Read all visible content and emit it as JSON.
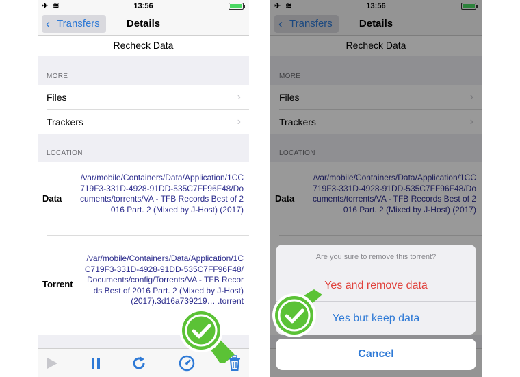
{
  "status_bar": {
    "left": "✈ ≋",
    "time": "13:56",
    "battery_level": 0.9
  },
  "nav": {
    "back_label": "Transfers",
    "back_chevron": "‹",
    "title": "Details"
  },
  "recheck_label": "Recheck Data",
  "more_section": {
    "header": "MORE",
    "items": [
      {
        "label": "Files",
        "chevron": "›"
      },
      {
        "label": "Trackers",
        "chevron": "›"
      }
    ]
  },
  "location_section": {
    "header": "LOCATION",
    "data_label": "Data",
    "data_value": "/var/mobile/Containers/Data/Application/1CC719F3-331D-4928-91DD-535C7FF96F48/Documents/torrents/VA - TFB Records Best of 2016 Part. 2 (Mixed by J-Host) (2017)",
    "torrent_label": "Torrent",
    "torrent_value": "/var/mobile/Containers/Data/Application/1CC719F3-331D-4928-91DD-535C7FF96F48/Documents/config/Torrents/VA - TFB Records Best of 2016 Part. 2 (Mixed by J-Host) (2017).3d16a739219… .torrent"
  },
  "toolbar": {
    "icons": [
      "play-icon",
      "pause-icon",
      "refresh-icon",
      "speed-icon",
      "trash-icon"
    ]
  },
  "action_sheet": {
    "title": "Are you sure to remove this torrent?",
    "remove_with_data": "Yes and remove data",
    "remove_keep_data": "Yes but keep data",
    "cancel": "Cancel"
  },
  "colors": {
    "ios_blue": "#2f7ad6",
    "destructive_red": "#e0413b",
    "badge_green": "#5bc236",
    "path_text": "#2e2e8e"
  },
  "badges": [
    "check-badge-icon",
    "check-badge-icon"
  ]
}
